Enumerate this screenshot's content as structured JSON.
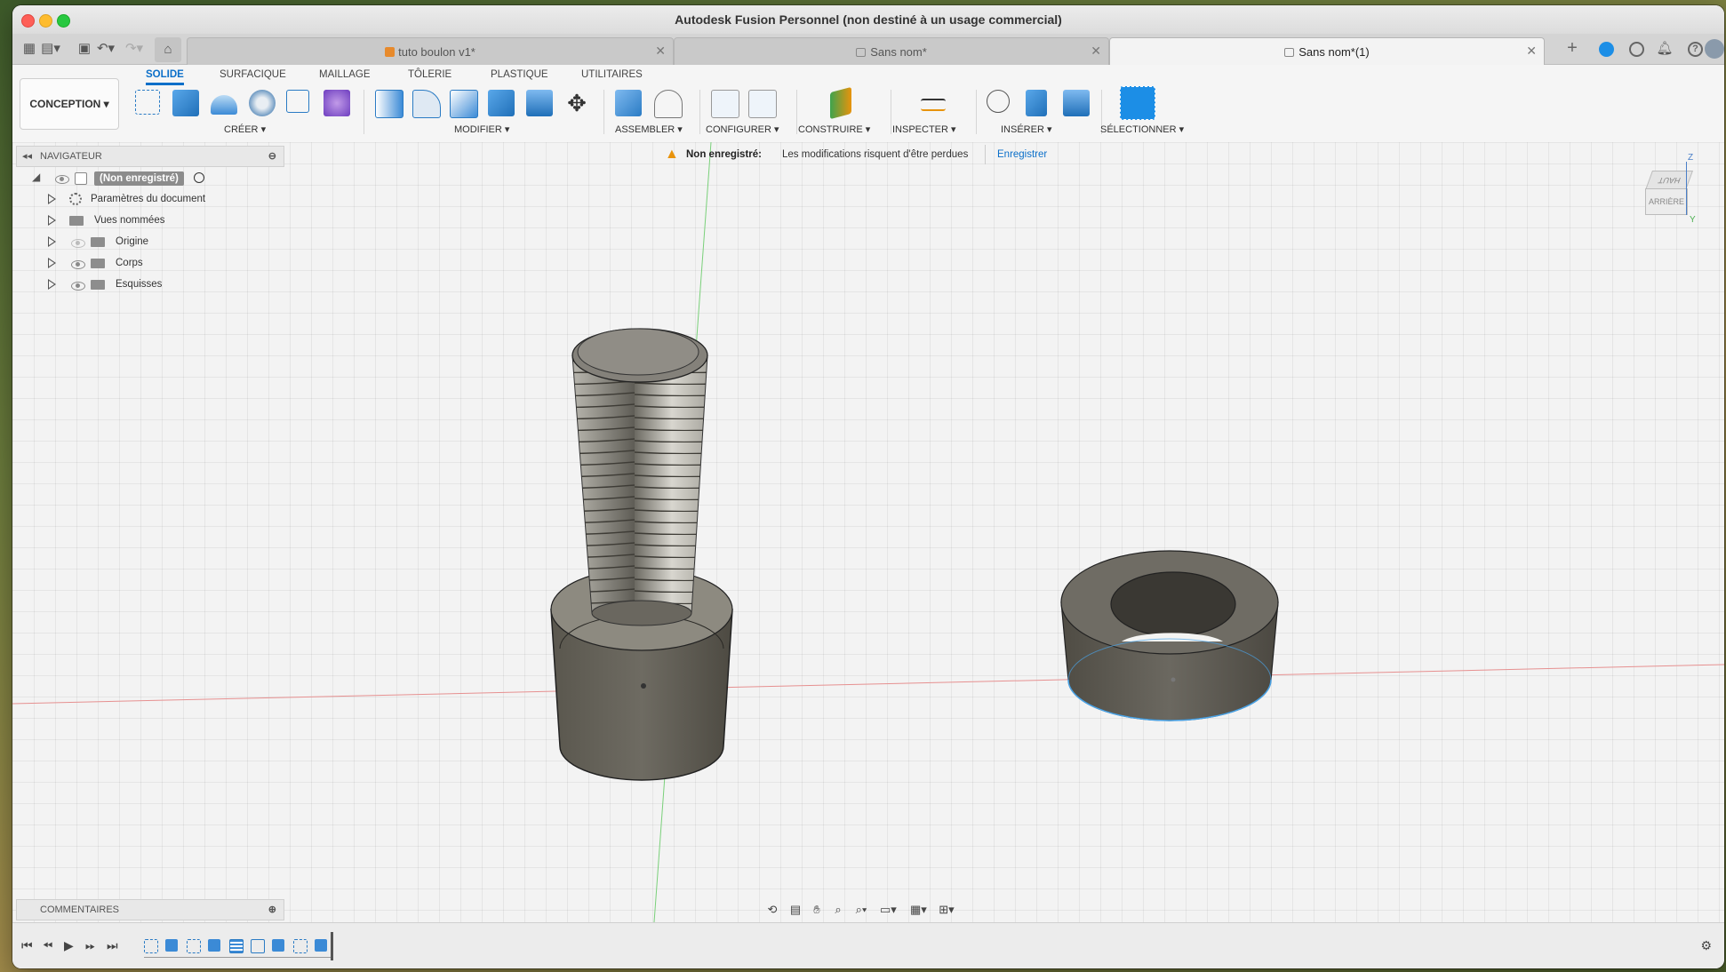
{
  "window": {
    "title": "Autodesk Fusion Personnel (non destiné à un usage commercial)"
  },
  "tabs": [
    {
      "label": "tuto boulon v1*",
      "icon": "component-cube-icon",
      "active": false
    },
    {
      "label": "Sans nom*",
      "icon": "lock-icon",
      "active": false
    },
    {
      "label": "Sans nom*(1)",
      "icon": "lock-icon",
      "active": true
    }
  ],
  "workspace": {
    "label": "CONCEPTION"
  },
  "category_tabs": [
    {
      "label": "SOLIDE",
      "active": true
    },
    {
      "label": "SURFACIQUE",
      "active": false
    },
    {
      "label": "MAILLAGE",
      "active": false
    },
    {
      "label": "TÔLERIE",
      "active": false
    },
    {
      "label": "PLASTIQUE",
      "active": false
    },
    {
      "label": "UTILITAIRES",
      "active": false
    }
  ],
  "tool_groups": {
    "create": "CRÉER",
    "modify": "MODIFIER",
    "assemble": "ASSEMBLER",
    "configure": "CONFIGURER",
    "construct": "CONSTRUIRE",
    "inspect": "INSPECTER",
    "insert": "INSÉRER",
    "select": "SÉLECTIONNER"
  },
  "navigator": {
    "title": "NAVIGATEUR",
    "root": "(Non enregistré)",
    "items": [
      {
        "label": "Paramètres du document",
        "icon": "gear-icon"
      },
      {
        "label": "Vues nommées",
        "icon": "folder-icon"
      },
      {
        "label": "Origine",
        "icon": "folder-icon"
      },
      {
        "label": "Corps",
        "icon": "folder-icon"
      },
      {
        "label": "Esquisses",
        "icon": "folder-icon"
      }
    ]
  },
  "banner": {
    "status": "Non enregistré:",
    "message": "Les modifications risquent d'être perdues",
    "action": "Enregistrer"
  },
  "viewcube": {
    "top": "HAUT",
    "back": "ARRIÈRE",
    "axis_z": "Z",
    "axis_y": "Y"
  },
  "comments": {
    "title": "COMMENTAIRES"
  },
  "colors": {
    "accent": "#0b6fc9",
    "warning": "#e8930c"
  }
}
